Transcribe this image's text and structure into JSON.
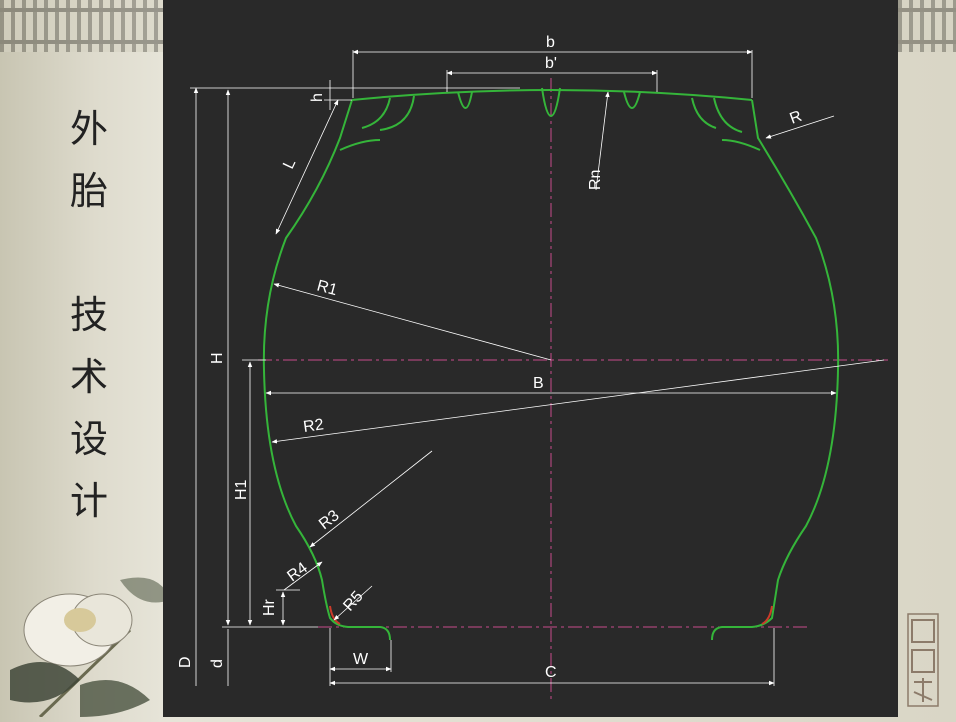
{
  "slide": {
    "title_chars": [
      "外",
      "胎",
      "",
      "技",
      "术",
      "设",
      "计"
    ]
  },
  "diagram": {
    "labels": {
      "b": "b",
      "b_prime": "b'",
      "h": "h",
      "R": "R",
      "L": "L",
      "Rn": "Rn",
      "R1": "R1",
      "H": "H",
      "B": "B",
      "R2": "R2",
      "H1": "H1",
      "R3": "R3",
      "R4": "R4",
      "Hr": "Hr",
      "R5": "R5",
      "D": "D",
      "d": "d",
      "W": "W",
      "C": "C"
    }
  },
  "colors": {
    "panel": "#292929",
    "profile": "#35b53a",
    "dimension": "#ffffff",
    "centerline": "#c84c8c",
    "bead_marker": "#cc3b2a"
  },
  "decor": {
    "flower": "peony-painting",
    "seal": "china-style-seal-stamp"
  }
}
